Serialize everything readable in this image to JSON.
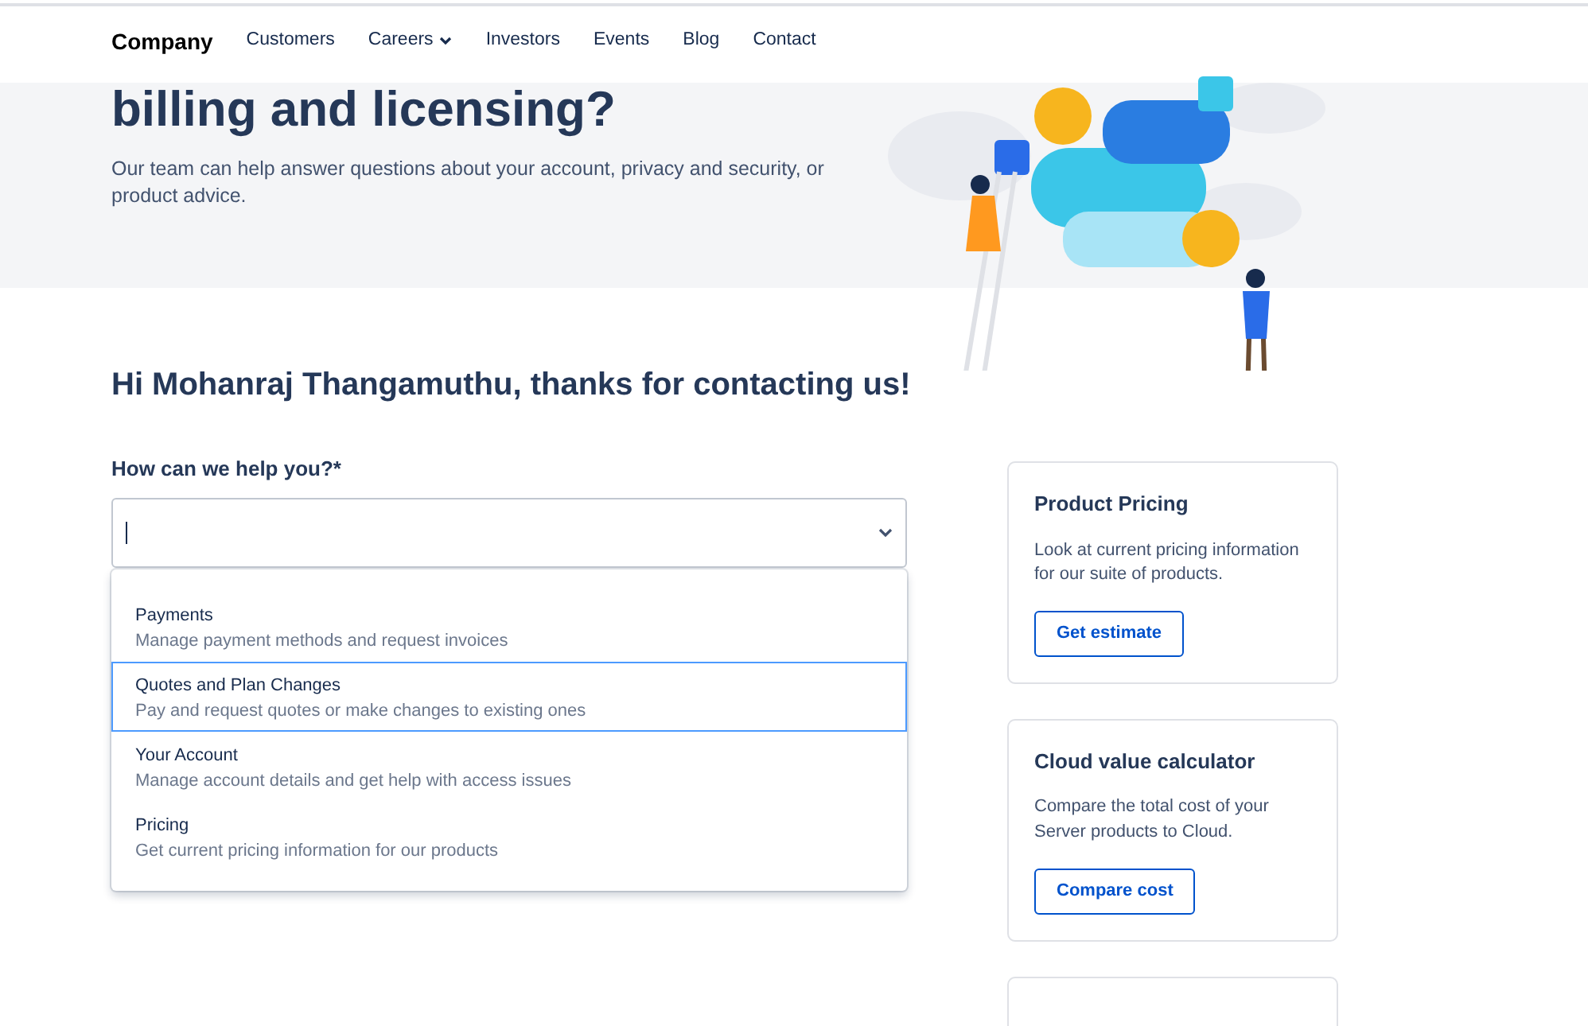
{
  "navbar": {
    "brand": "Company",
    "items": [
      {
        "label": "Customers",
        "has_menu": false
      },
      {
        "label": "Careers",
        "has_menu": true
      },
      {
        "label": "Investors",
        "has_menu": false
      },
      {
        "label": "Events",
        "has_menu": false
      },
      {
        "label": "Blog",
        "has_menu": false
      },
      {
        "label": "Contact",
        "has_menu": false
      }
    ]
  },
  "hero": {
    "title": "billing and licensing?",
    "text": "Our team can help answer questions about your account, privacy and security, or product advice."
  },
  "greeting": "Hi Mohanraj Thangamuthu, thanks for contacting us!",
  "help_field": {
    "label": "How can we help you?*",
    "expanded": true,
    "options": [
      {
        "title": "Payments",
        "description": "Manage payment methods and request invoices",
        "selected": false
      },
      {
        "title": "Quotes and Plan Changes",
        "description": "Pay and request quotes or make changes to existing ones",
        "selected": true
      },
      {
        "title": "Your Account",
        "description": "Manage account details and get help with access issues",
        "selected": false
      },
      {
        "title": "Pricing",
        "description": "Get current pricing information for our products",
        "selected": false
      }
    ]
  },
  "cards": [
    {
      "title": "Product Pricing",
      "text": "Look at current pricing information for our suite of products.",
      "button": "Get estimate"
    },
    {
      "title": "Cloud value calculator",
      "text": "Compare the total cost of your Server products to Cloud.",
      "button": "Compare cost"
    }
  ]
}
